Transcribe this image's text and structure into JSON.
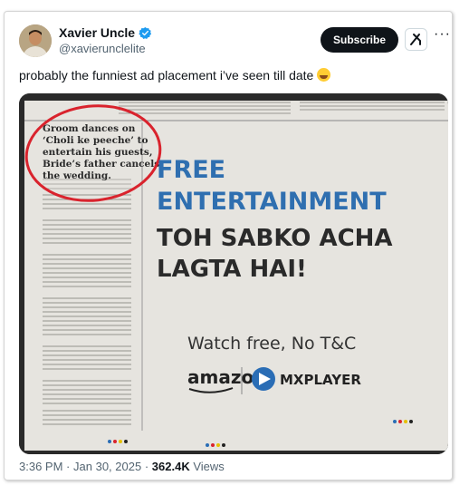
{
  "author": {
    "name": "Xavier Uncle",
    "handle": "@xavierunclelite"
  },
  "actions": {
    "subscribe_label": "Subscribe",
    "more_label": "···"
  },
  "tweet": {
    "text": "probably the funniest ad placement i’ve seen till date"
  },
  "image": {
    "news_headline": [
      "Groom dances on",
      "‘Choli ke peeche’ to",
      "entertain his guests,",
      "Bride’s father cancels",
      "the wedding."
    ],
    "ad_line_1": "FREE",
    "ad_line_2": "ENTERTAINMENT",
    "ad_line_3": "TOH SABKO ACHA",
    "ad_line_4": "LAGTA HAI!",
    "ad_tagline": "Watch free, No T&C",
    "brand_amazon": "amazon",
    "brand_mx": "MXPLAYER"
  },
  "meta": {
    "time": "3:36 PM",
    "date": "Jan 30, 2025",
    "separator": "·",
    "views_count": "362.4K",
    "views_label": "Views"
  },
  "colors": {
    "ad_blue": "#2f6fb0",
    "ad_dark": "#2a2a2a",
    "circle_red": "#d9232d",
    "mx_blue": "#2a6db5"
  }
}
